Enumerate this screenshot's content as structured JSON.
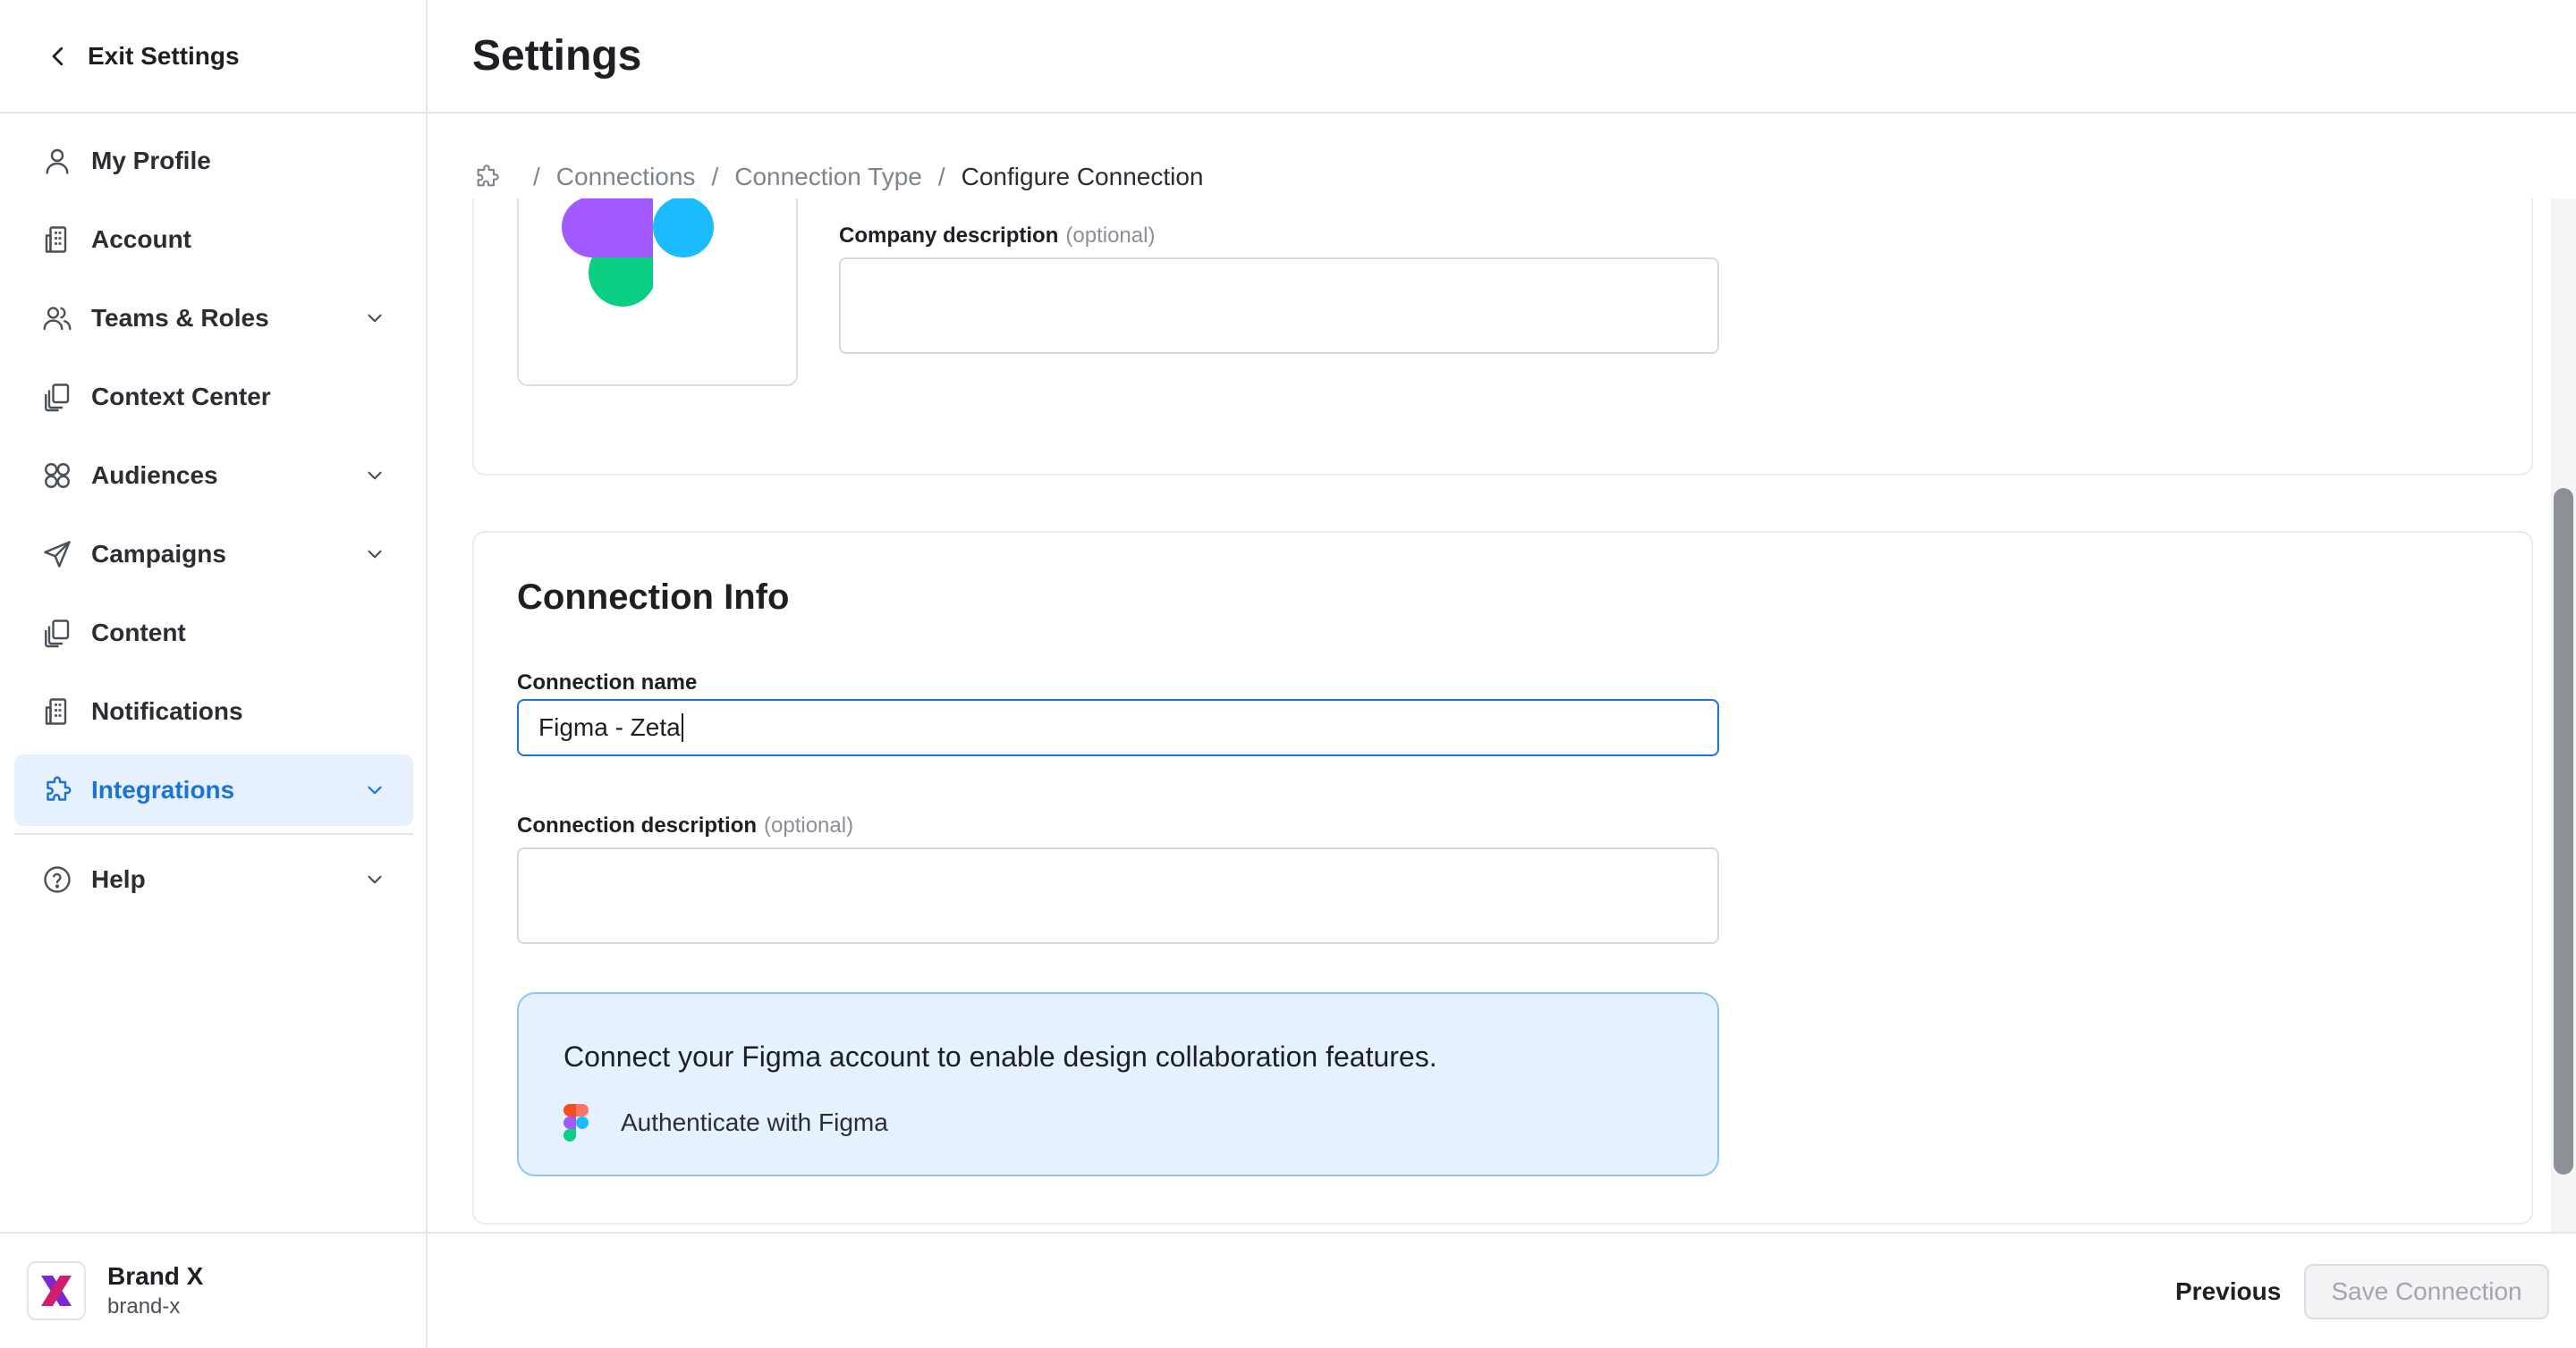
{
  "sidebar": {
    "exit_label": "Exit Settings",
    "items": [
      {
        "label": "My Profile",
        "icon": "user-icon",
        "has_chevron": false
      },
      {
        "label": "Account",
        "icon": "building-icon",
        "has_chevron": false
      },
      {
        "label": "Teams & Roles",
        "icon": "users-icon",
        "has_chevron": true
      },
      {
        "label": "Context Center",
        "icon": "documents-icon",
        "has_chevron": false
      },
      {
        "label": "Audiences",
        "icon": "audience-icon",
        "has_chevron": true
      },
      {
        "label": "Campaigns",
        "icon": "send-icon",
        "has_chevron": true
      },
      {
        "label": "Content",
        "icon": "documents-icon",
        "has_chevron": false
      },
      {
        "label": "Notifications",
        "icon": "building-icon",
        "has_chevron": false
      },
      {
        "label": "Integrations",
        "icon": "puzzle-icon",
        "has_chevron": true,
        "active": true
      },
      {
        "label": "Help",
        "icon": "help-icon",
        "has_chevron": true
      }
    ],
    "brand": {
      "name": "Brand X",
      "handle": "brand-x"
    }
  },
  "header": {
    "title": "Settings"
  },
  "breadcrumb": {
    "items": [
      "Connections",
      "Connection Type"
    ],
    "current": "Configure Connection",
    "separator": "/"
  },
  "company": {
    "description_label": "Company description",
    "optional": "(optional)",
    "description_value": ""
  },
  "connection_info": {
    "title": "Connection Info",
    "name_label": "Connection name",
    "name_value": "Figma - Zeta",
    "description_label": "Connection description",
    "optional": "(optional)",
    "description_value": "",
    "info_text": "Connect your Figma account to enable design collaboration features.",
    "auth_label": "Authenticate with Figma"
  },
  "footer": {
    "previous_label": "Previous",
    "save_label": "Save Connection"
  },
  "colors": {
    "accent": "#1a73d9",
    "active_bg": "#e7f1fd",
    "info_bg": "#e5f2fd",
    "info_border": "#8ec5f2"
  }
}
